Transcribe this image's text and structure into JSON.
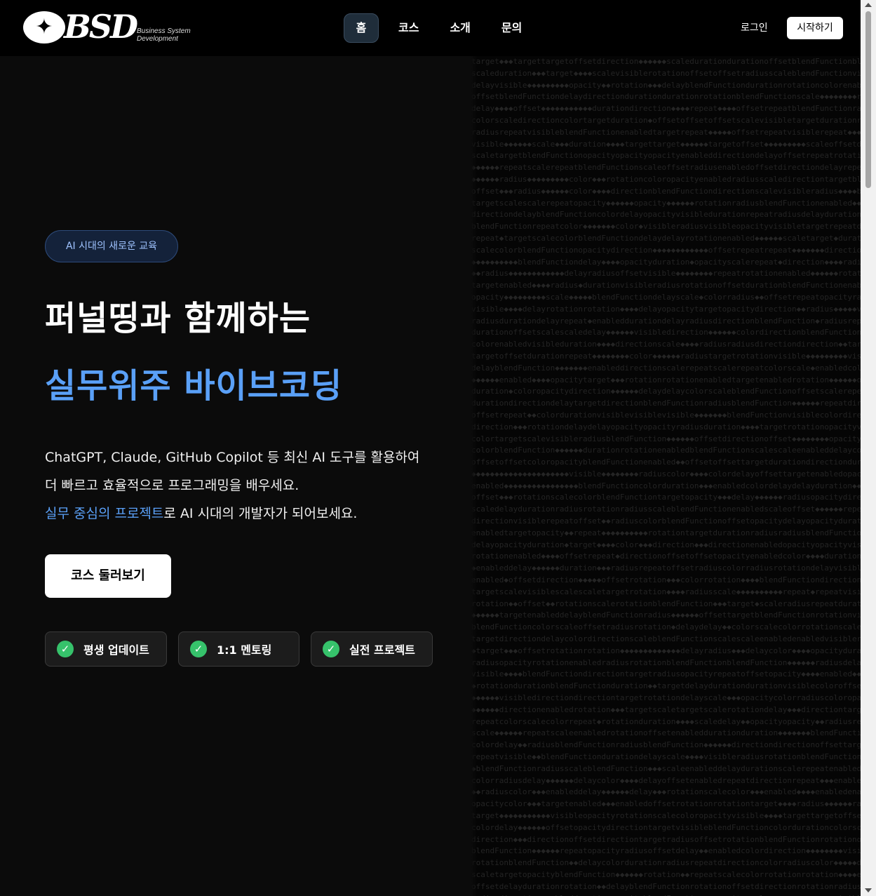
{
  "brand": {
    "logo_text": "BSD",
    "logo_sub": "Business System Development",
    "logo_icon": "star-icon"
  },
  "nav": {
    "items": [
      {
        "label": "홈",
        "active": true
      },
      {
        "label": "코스",
        "active": false
      },
      {
        "label": "소개",
        "active": false
      },
      {
        "label": "문의",
        "active": false
      }
    ]
  },
  "header_actions": {
    "login_label": "로그인",
    "start_label": "시작하기"
  },
  "hero": {
    "badge": "AI 시대의 새로운 교육",
    "headline_line1": "퍼널띵과 함께하는",
    "headline_line2": "실무위주 바이브코딩",
    "desc_line1": "ChatGPT, Claude, GitHub Copilot 등 최신 AI 도구를 활용하여",
    "desc_line2": "더 빠르고 효율적으로 프로그래밍을 배우세요.",
    "desc_line3_highlight": "실무 중심의 프로젝트",
    "desc_line3_rest": "로 AI 시대의 개발자가 되어보세요.",
    "cta_label": "코스 둘러보기"
  },
  "features": [
    {
      "label": "평생 업데이트",
      "icon": "check-icon"
    },
    {
      "label": "1:1 멘토링",
      "icon": "check-icon"
    },
    {
      "label": "실전 프로젝트",
      "icon": "check-icon"
    }
  ],
  "colors": {
    "background": "#0b0b0b",
    "accent": "#5aa0f7",
    "check": "#36c26b"
  }
}
